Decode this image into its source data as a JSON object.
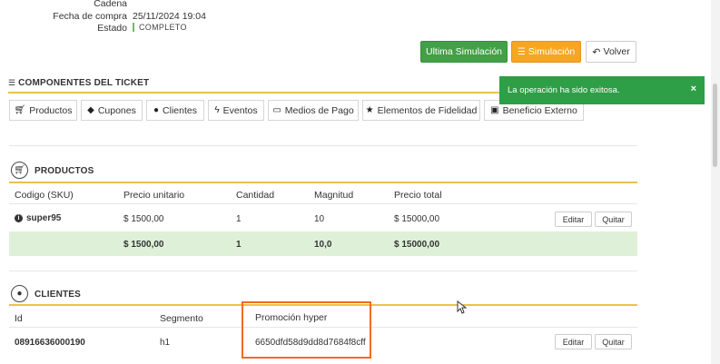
{
  "meta": {
    "cadena_label": "Cadena",
    "fecha_label": "Fecha de compra",
    "fecha_value": "25/11/2024 19:04",
    "estado_label": "Estado",
    "estado_value": "COMPLETO"
  },
  "actions": {
    "ultima_simulacion": "Ultima Simulación",
    "simulacion": "Simulación",
    "volver": "Volver"
  },
  "toast": {
    "message": "La operación ha sido exitosa.",
    "close": "×"
  },
  "componentes": {
    "title": "COMPONENTES DEL TICKET",
    "tabs": [
      {
        "label": "Productos"
      },
      {
        "label": "Cupones"
      },
      {
        "label": "Clientes"
      },
      {
        "label": "Eventos"
      },
      {
        "label": "Medios de Pago"
      },
      {
        "label": "Elementos de Fidelidad"
      },
      {
        "label": "Beneficio Externo"
      }
    ]
  },
  "productos": {
    "title": "PRODUCTOS",
    "headers": [
      "Codigo (SKU)",
      "Precio unitario",
      "Cantidad",
      "Magnitud",
      "Precio total"
    ],
    "row": {
      "sku": "super95",
      "precio_unitario": "$ 1500,00",
      "cantidad": "1",
      "magnitud": "10",
      "precio_total": "$ 15000,00"
    },
    "totals": {
      "precio_unitario": "$ 1500,00",
      "cantidad": "1",
      "magnitud": "10,0",
      "precio_total": "$ 15000,00"
    },
    "edit": "Editar",
    "remove": "Quitar"
  },
  "clientes": {
    "title": "CLIENTES",
    "headers": [
      "Id",
      "Segmento",
      "Promoción hyper"
    ],
    "row": {
      "id": "08916636000190",
      "segmento": "h1",
      "promocion": "6650dfd58d9dd8d7684f8cff"
    },
    "edit": "Editar",
    "remove": "Quitar"
  },
  "colors": {
    "green": "#43a047",
    "orange": "#f6a623",
    "toast": "#2e9e47",
    "highlight_border": "#f26a21",
    "total_row": "#dff0d8",
    "section_underline": "#e8c34a"
  }
}
